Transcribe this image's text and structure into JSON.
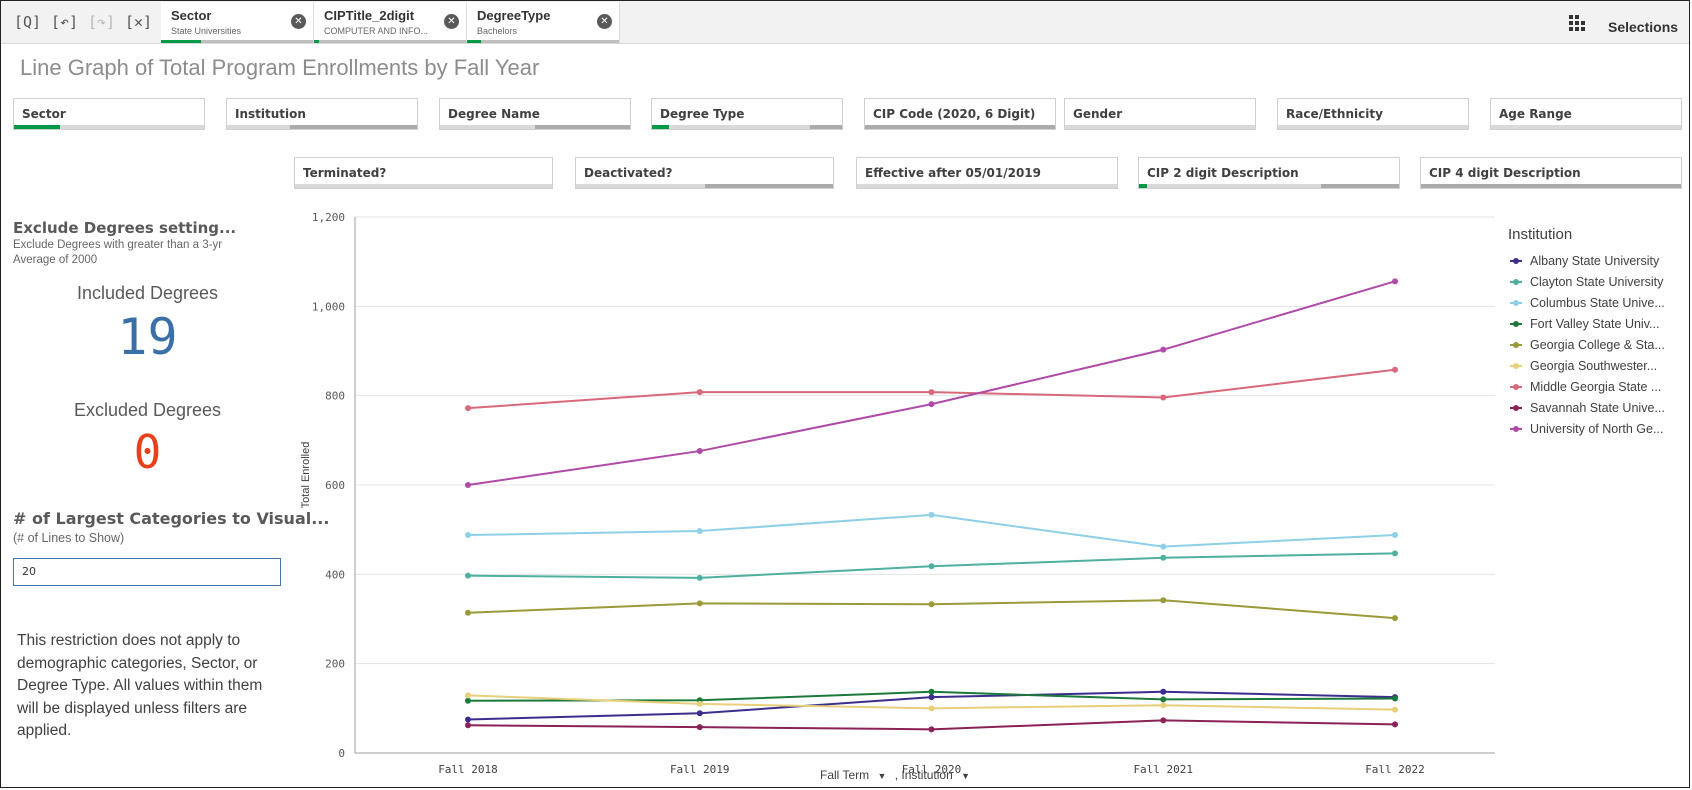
{
  "toolbar": {
    "chips": [
      {
        "title": "Sector",
        "value": "State Universities"
      },
      {
        "title": "CIPTitle_2digit",
        "value": "COMPUTER AND INFO..."
      },
      {
        "title": "DegreeType",
        "value": "Bachelors"
      }
    ],
    "selections_label": "Selections"
  },
  "page_title": "Line Graph of Total Program Enrollments by Fall Year",
  "filters_row1": [
    "Sector",
    "Institution",
    "Degree Name",
    "Degree Type",
    "CIP Code (2020, 6 Digit)",
    "Gender",
    "Race/Ethnicity",
    "Age Range"
  ],
  "filters_row2": [
    "Terminated?",
    "Deactivated?",
    "Effective after 05/01/2019",
    "CIP 2 digit Description",
    "CIP 4 digit Description"
  ],
  "left_panel": {
    "exclude_title": "Exclude Degrees setting...",
    "exclude_sub": "Exclude Degrees with greater than a 3-yr Average of 2000",
    "included_label": "Included Degrees",
    "included_value": "19",
    "excluded_label": "Excluded Degrees",
    "excluded_value": "0",
    "categories_title": "# of Largest Categories to Visual...",
    "categories_sub": "(# of Lines to Show)",
    "categories_value": "20",
    "note": "This restriction does not apply to demographic categories, Sector, or Degree Type. All values within them will be displayed unless filters are applied."
  },
  "colors": {
    "accent_green": "#009845",
    "included_blue": "#3a6fa8",
    "excluded_red": "#e8401c"
  },
  "chart_data": {
    "type": "line",
    "title": "",
    "xlabel": "Fall Term",
    "xlabel_suffix": ", Institution",
    "ylabel": "Total Enrolled",
    "ylim": [
      0,
      1200
    ],
    "yticks": [
      "0",
      "200",
      "400",
      "600",
      "800",
      "1,000",
      "1,200"
    ],
    "categories": [
      "Fall 2018",
      "Fall 2019",
      "Fall 2020",
      "Fall 2021",
      "Fall 2022"
    ],
    "legend_title": "Institution",
    "legend_placement": "right",
    "grid": true,
    "series": [
      {
        "name": "Albany State University",
        "legend_label": "Albany State University",
        "color": "#3b2e8f",
        "values": [
          75,
          89,
          125,
          137,
          125
        ]
      },
      {
        "name": "Clayton State University",
        "legend_label": "Clayton State University",
        "color": "#4fb0a0",
        "values": [
          397,
          392,
          418,
          437,
          447
        ]
      },
      {
        "name": "Columbus State University",
        "legend_label": "Columbus State Unive...",
        "color": "#8ecfe8",
        "values": [
          488,
          497,
          533,
          462,
          488
        ]
      },
      {
        "name": "Fort Valley State University",
        "legend_label": "Fort Valley State Univ...",
        "color": "#1b7a3a",
        "values": [
          117,
          118,
          137,
          120,
          122
        ]
      },
      {
        "name": "Georgia College & State University",
        "legend_label": "Georgia College & Sta...",
        "color": "#9a9a3a",
        "values": [
          314,
          335,
          333,
          342,
          302
        ]
      },
      {
        "name": "Georgia Southwestern",
        "legend_label": "Georgia Southwester...",
        "color": "#e8cf7a",
        "values": [
          129,
          110,
          100,
          107,
          97
        ]
      },
      {
        "name": "Middle Georgia State",
        "legend_label": "Middle Georgia State ...",
        "color": "#d9687a",
        "values": [
          772,
          808,
          808,
          796,
          858
        ]
      },
      {
        "name": "Savannah State University",
        "legend_label": "Savannah State Unive...",
        "color": "#8b2257",
        "values": [
          62,
          58,
          53,
          73,
          64
        ]
      },
      {
        "name": "University of North Georgia",
        "legend_label": "University of North Ge...",
        "color": "#b04aa8",
        "values": [
          600,
          676,
          781,
          903,
          1056
        ]
      }
    ]
  }
}
